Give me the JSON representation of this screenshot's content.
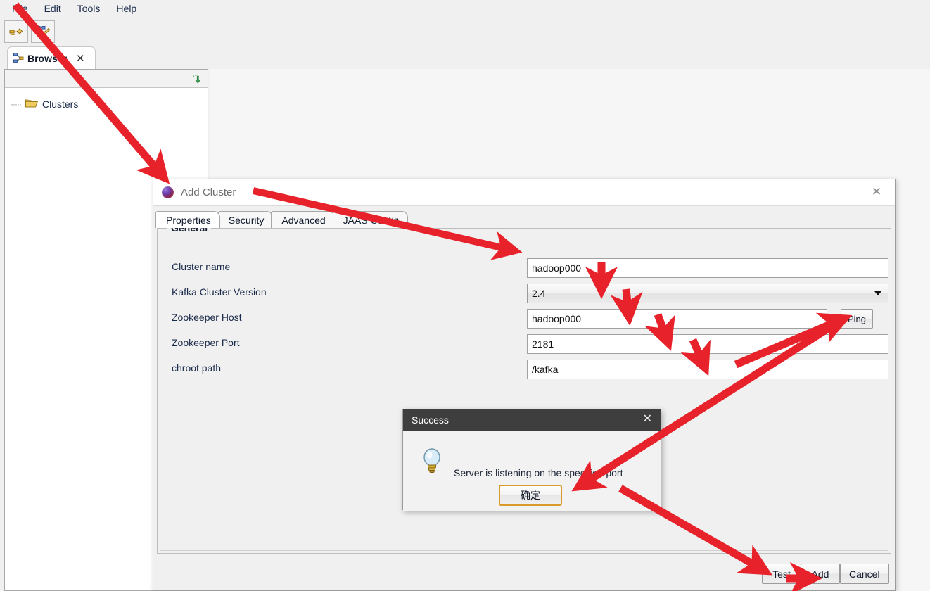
{
  "app": {
    "menu": [
      {
        "label": "File",
        "mnemonic": "F"
      },
      {
        "label": "Edit",
        "mnemonic": "E"
      },
      {
        "label": "Tools",
        "mnemonic": "T"
      },
      {
        "label": "Help",
        "mnemonic": "H"
      }
    ],
    "toolbar": [
      {
        "name": "add-cluster-tool-icon",
        "glyph": "⚷"
      },
      {
        "name": "edit-cluster-tool-icon",
        "glyph": "✎"
      }
    ],
    "tabs": [
      {
        "label": "Browser",
        "icon": "browser-tree-icon",
        "close": "✕",
        "active": true
      }
    ],
    "tree": {
      "refresh_icon": "refresh-download-icon",
      "root_label": "Clusters",
      "folder_icon": "folder-open-icon"
    }
  },
  "dialog": {
    "title": "Add Cluster",
    "icon": "cluster-sphere-icon",
    "close_label": "✕",
    "tabs": [
      {
        "label": "Properties",
        "active": true
      },
      {
        "label": "Security",
        "active": false
      },
      {
        "label": "Advanced",
        "active": false
      },
      {
        "label": "JAAS Config",
        "active": false
      }
    ],
    "group_legend": "General",
    "fields": [
      {
        "label": "Cluster name",
        "value": "hadoop000",
        "type": "text",
        "name": "cluster-name"
      },
      {
        "label": "Kafka Cluster Version",
        "value": "2.4",
        "type": "combo",
        "name": "kafka-cluster-version"
      },
      {
        "label": "Zookeeper Host",
        "value": "hadoop000",
        "type": "text-with-button",
        "button": "Ping",
        "name": "zookeeper-host"
      },
      {
        "label": "Zookeeper Port",
        "value": "2181",
        "type": "text",
        "name": "zookeeper-port"
      },
      {
        "label": "chroot path",
        "value": "/kafka",
        "type": "text",
        "name": "chroot-path"
      }
    ],
    "buttons": [
      {
        "label": "Test",
        "name": "test-button"
      },
      {
        "label": "Add",
        "name": "add-button"
      },
      {
        "label": "Cancel",
        "name": "cancel-button"
      }
    ]
  },
  "success_dialog": {
    "title": "Success",
    "close_label": "✕",
    "message": "Server is listening on the specified port",
    "ok_label": "确定",
    "icon": "lightbulb-icon"
  },
  "annotations": {
    "color": "#e8222a",
    "count": 8,
    "description": "red arrows pointing to File menu origin, dialog fields, Ping button, OK button and Add button"
  }
}
